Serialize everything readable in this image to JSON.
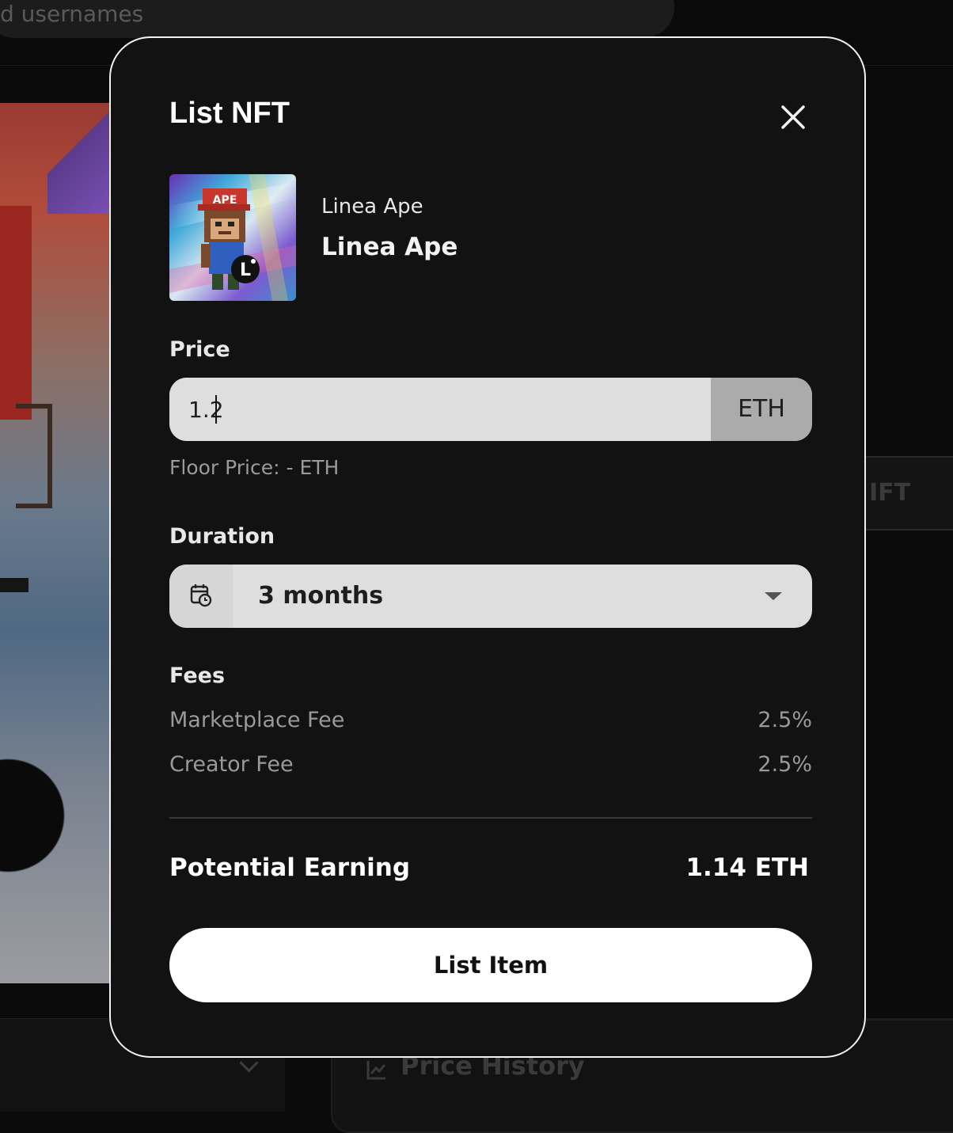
{
  "background": {
    "search_placeholder": "d usernames",
    "button_partial": "IFT",
    "tab_price_history": "Price History"
  },
  "modal": {
    "title": "List NFT",
    "nft": {
      "collection": "Linea Ape",
      "name": "Linea Ape",
      "thumb_cap_text": "APE",
      "thumb_badge_text": "L"
    },
    "price": {
      "label": "Price",
      "value": "1.2",
      "currency": "ETH",
      "floor_price": "Floor Price: - ETH"
    },
    "duration": {
      "label": "Duration",
      "value": "3 months"
    },
    "fees": {
      "label": "Fees",
      "items": [
        {
          "name": "Marketplace Fee",
          "value": "2.5%"
        },
        {
          "name": "Creator Fee",
          "value": "2.5%"
        }
      ]
    },
    "earning": {
      "label": "Potential Earning",
      "value": "1.14 ETH"
    },
    "submit_label": "List Item"
  },
  "icons": [
    "close-icon",
    "calendar-clock-icon",
    "chevron-down-icon",
    "chart-icon"
  ],
  "colors": {
    "modal_bg": "#121212",
    "modal_border": "#f2f2f2",
    "input_bg": "#dedede",
    "currency_bg": "#ababab",
    "button_bg": "#ffffff"
  }
}
